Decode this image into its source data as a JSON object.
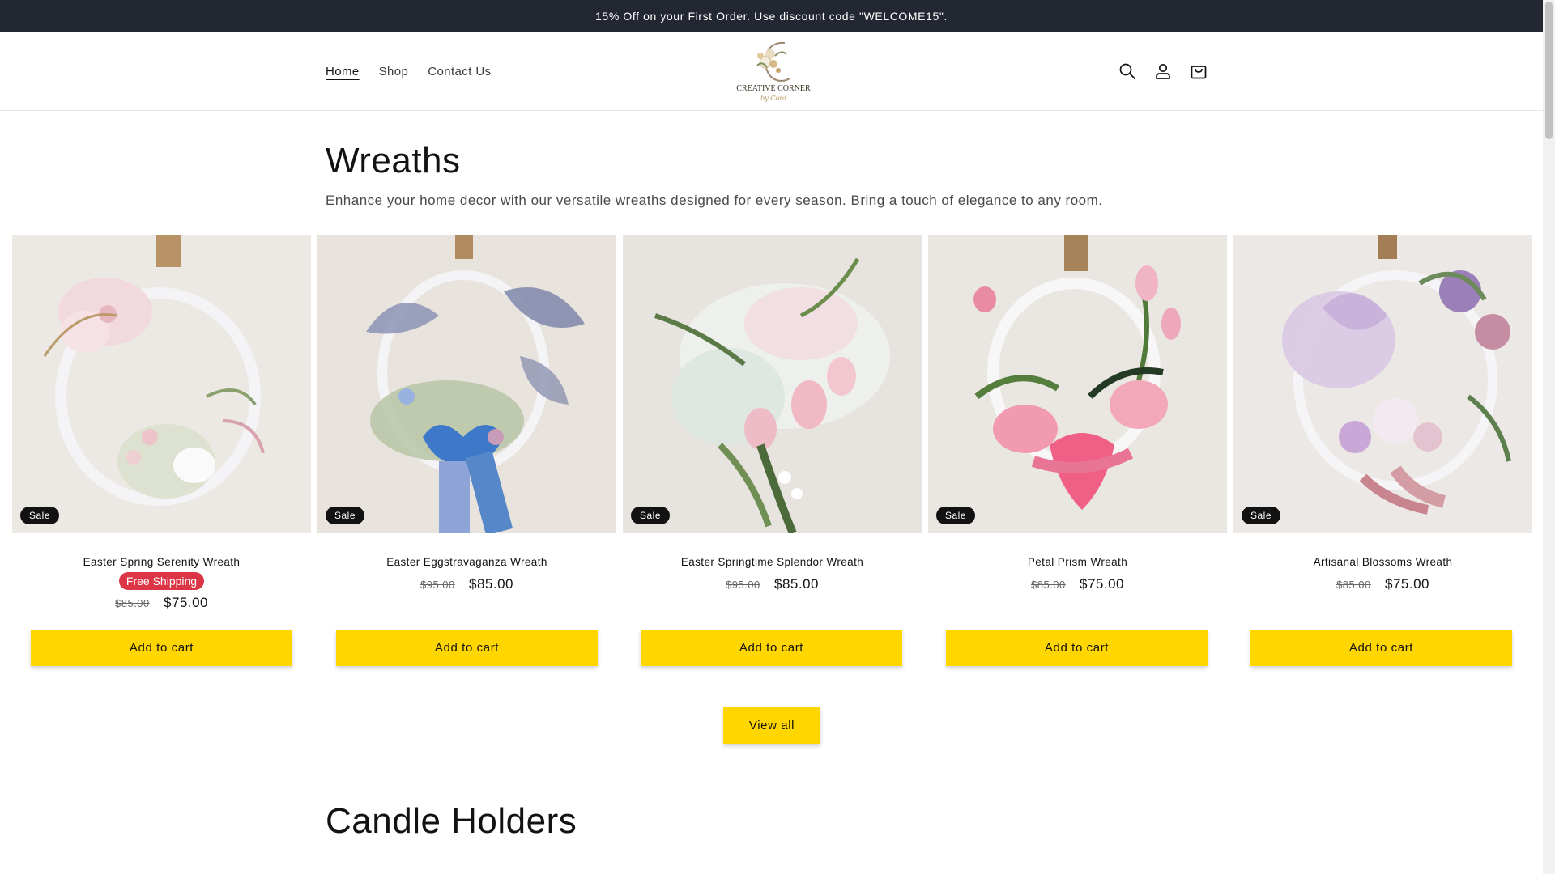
{
  "announcement": {
    "text": "15% Off on your First Order. Use discount code \"WELCOME15\"."
  },
  "nav": {
    "items": [
      {
        "label": "Home"
      },
      {
        "label": "Shop"
      },
      {
        "label": "Contact Us"
      }
    ]
  },
  "logo": {
    "name": "CREATIVE CORNER",
    "script": "by Cora"
  },
  "header_icons": [
    "search-icon",
    "account-icon",
    "cart-icon"
  ],
  "wreaths": {
    "title": "Wreaths",
    "description": "Enhance your home decor with our versatile wreaths designed for every season. Bring a touch of elegance to any room.",
    "products": [
      {
        "badge": "Sale",
        "title": "Easter Spring Serenity Wreath",
        "shipping": "Free Shipping",
        "old_price": "$85.00",
        "price": "$75.00",
        "button": "Add to cart"
      },
      {
        "badge": "Sale",
        "title": "Easter Eggstravaganza Wreath",
        "old_price": "$95.00",
        "price": "$85.00",
        "button": "Add to cart"
      },
      {
        "badge": "Sale",
        "title": "Easter Springtime Splendor Wreath",
        "old_price": "$95.00",
        "price": "$85.00",
        "button": "Add to cart"
      },
      {
        "badge": "Sale",
        "title": "Petal Prism Wreath",
        "old_price": "$85.00",
        "price": "$75.00",
        "button": "Add to cart"
      },
      {
        "badge": "Sale",
        "title": "Artisanal Blossoms Wreath",
        "old_price": "$85.00",
        "price": "$75.00",
        "button": "Add to cart"
      }
    ],
    "view_all": "View all"
  },
  "candle_holders": {
    "title": "Candle Holders"
  },
  "colors": {
    "announcement_bg": "#232731",
    "button_yellow": "#ffd600",
    "badge_bg": "#121212",
    "free_shipping_red": "#dc3545"
  }
}
